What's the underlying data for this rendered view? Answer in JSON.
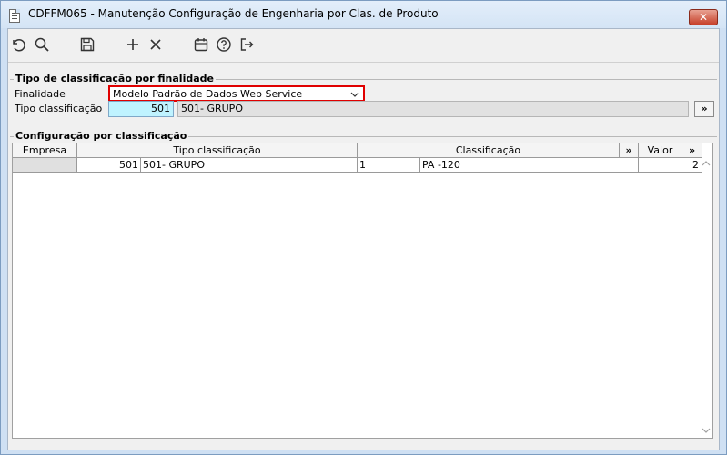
{
  "window": {
    "title": "CDFFM065 - Manutenção Configuração de Engenharia por Clas. de Produto",
    "close_label": "✕"
  },
  "toolbar": {
    "icons": [
      "refresh-icon",
      "search-icon",
      "save-icon",
      "add-icon",
      "delete-icon",
      "calendar-icon",
      "help-icon",
      "exit-icon"
    ]
  },
  "section1": {
    "title": "Tipo de classificação por finalidade",
    "finalidade_label": "Finalidade",
    "finalidade_value": "Modelo Padrão de Dados Web Service",
    "tipo_label": "Tipo classificação",
    "tipo_code": "501",
    "tipo_desc": "501- GRUPO",
    "more_label": "»"
  },
  "section2": {
    "title": "Configuração por classificação",
    "columns": {
      "empresa": "Empresa",
      "tipo": "Tipo classificação",
      "classificacao": "Classificação",
      "more1": "»",
      "valor": "Valor",
      "more2": "»"
    },
    "rows": [
      {
        "empresa": "",
        "tipo_code": "501",
        "tipo_desc": "501- GRUPO",
        "class_code": "1",
        "class_desc": "PA -120",
        "valor": "2"
      }
    ]
  },
  "colors": {
    "highlight_border": "#e00000",
    "code_field_bg": "#bff3ff",
    "frame_bg": "#cfe0f3",
    "close_button": "#c7402a"
  }
}
